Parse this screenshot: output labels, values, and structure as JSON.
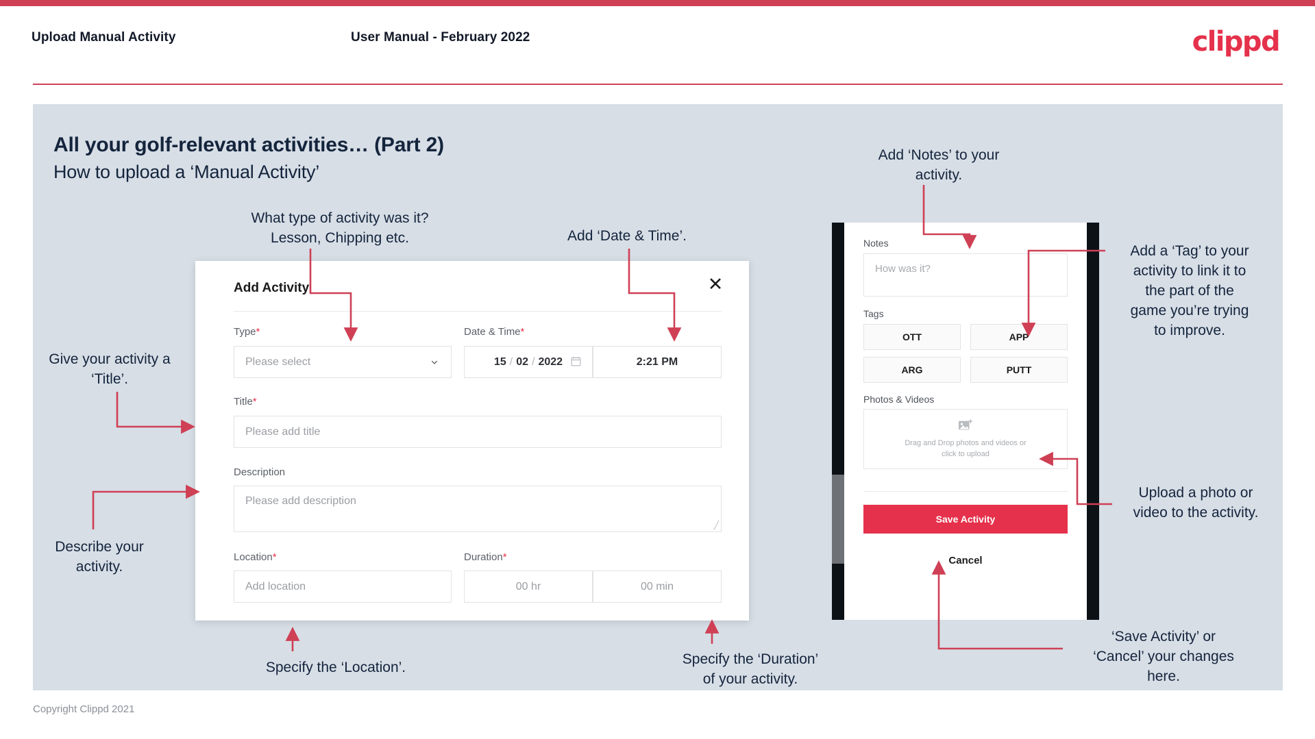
{
  "header": {
    "title": "Upload Manual Activity",
    "subtitle": "User Manual - February 2022",
    "logo": "clippd"
  },
  "slide": {
    "title": "All your golf-relevant activities… (Part 2)",
    "subtitle": "How to upload a ‘Manual Activity’",
    "footer": "Copyright Clippd 2021"
  },
  "dialog": {
    "title": "Add Activity",
    "close_icon": "close-icon",
    "fields": {
      "type": {
        "label": "Type",
        "required": "*",
        "placeholder": "Please select"
      },
      "datetime": {
        "label": "Date & Time",
        "required": "*",
        "day": "15",
        "month": "02",
        "year": "2022",
        "sep": "/",
        "time": "2:21 PM"
      },
      "title": {
        "label": "Title",
        "required": "*",
        "placeholder": "Please add title"
      },
      "description": {
        "label": "Description",
        "placeholder": "Please add description"
      },
      "location": {
        "label": "Location",
        "required": "*",
        "placeholder": "Add location"
      },
      "duration": {
        "label": "Duration",
        "required": "*",
        "hours": "00 hr",
        "minutes": "00 min"
      }
    }
  },
  "phone": {
    "notes": {
      "label": "Notes",
      "placeholder": "How was it?"
    },
    "tags": {
      "label": "Tags",
      "items": [
        "OTT",
        "APP",
        "ARG",
        "PUTT"
      ]
    },
    "photos": {
      "label": "Photos & Videos",
      "drop_line1": "Drag and Drop photos and videos or",
      "drop_line2": "click to upload",
      "icon": "add-image-icon"
    },
    "save_label": "Save Activity",
    "cancel_label": "Cancel"
  },
  "annotations": {
    "type": "What type of activity was it?\nLesson, Chipping etc.",
    "datetime": "Add ‘Date & Time’.",
    "title": "Give your activity a\n‘Title’.",
    "description": "Describe your\nactivity.",
    "location": "Specify the ‘Location’.",
    "duration": "Specify the ‘Duration’\nof your activity.",
    "notes": "Add ‘Notes’ to your\nactivity.",
    "tags": "Add a ‘Tag’ to your\nactivity to link it to\nthe part of the\ngame you’re trying\nto improve.",
    "photos": "Upload a photo or\nvideo to the activity.",
    "save": "‘Save Activity’ or\n‘Cancel’ your changes\nhere."
  },
  "colors": {
    "brand": "#e5314b",
    "top_bar": "#cf4055",
    "slide_bg": "#d7dee6",
    "text_dark": "#14243c",
    "arrow": "#cf4055"
  }
}
